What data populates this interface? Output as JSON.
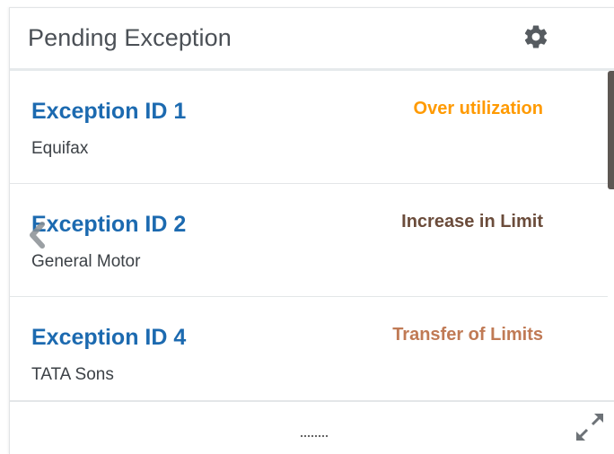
{
  "header": {
    "title": "Pending Exception",
    "settings_icon": "gear-icon"
  },
  "exceptions": [
    {
      "id": "Exception ID 1",
      "party": "Equifax",
      "type": "Over utilization",
      "type_color": "#ff9a00"
    },
    {
      "id": "Exception ID 2",
      "party": "General Motor",
      "type": "Increase in Limit",
      "type_color": "#6b4c3b"
    },
    {
      "id": "Exception ID 4",
      "party": "TATA Sons",
      "type": "Transfer of Limits",
      "type_color": "#c07a55"
    }
  ],
  "colors": {
    "exception_id": "#1c6ab0",
    "title": "#4b5056",
    "scroll_thumb": "#5d5753"
  },
  "controls": {
    "prev_icon": "chevron-left-icon",
    "resize_handle_icon": "drag-handle-icon",
    "expand_icon": "expand-icon"
  }
}
